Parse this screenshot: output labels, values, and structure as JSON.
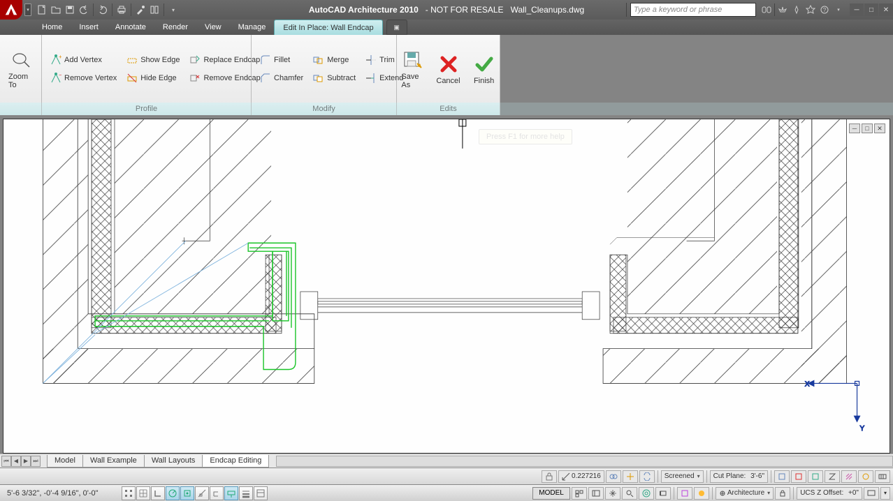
{
  "titlebar": {
    "app": "AutoCAD Architecture 2010",
    "warn": "- NOT FOR RESALE",
    "file": "Wall_Cleanups.dwg",
    "search_placeholder": "Type a keyword or phrase"
  },
  "menubar": {
    "items": [
      "Home",
      "Insert",
      "Annotate",
      "Render",
      "View",
      "Manage"
    ],
    "active": "Edit In Place: Wall Endcap"
  },
  "ribbon": {
    "zoom_to": "Zoom To",
    "profile": {
      "title": "Profile",
      "add_vertex": "Add Vertex",
      "remove_vertex": "Remove Vertex",
      "show_edge": "Show Edge",
      "hide_edge": "Hide Edge",
      "replace_endcap": "Replace Endcap",
      "remove_endcap": "Remove Endcap"
    },
    "modify": {
      "title": "Modify",
      "fillet": "Fillet",
      "chamfer": "Chamfer",
      "merge": "Merge",
      "subtract": "Subtract",
      "trim": "Trim",
      "extend": "Extend"
    },
    "edits": {
      "title": "Edits",
      "save_as": "Save As",
      "cancel": "Cancel",
      "finish": "Finish"
    }
  },
  "tooltip": "Press F1 for more help",
  "layout_tabs": {
    "items": [
      "Model",
      "Wall Example",
      "Wall Layouts",
      "Endcap Editing"
    ],
    "active_index": 3
  },
  "status1": {
    "scale_value": "0.227216",
    "visual_style": "Screened",
    "cut_plane_label": "Cut Plane:",
    "cut_plane_value": "3'-6\""
  },
  "status2": {
    "coords": "5'-6 3/32\",  -0'-4 9/16\",  0'-0\"",
    "model_btn": "MODEL",
    "workspace": "Architecture",
    "ucs_label": "UCS Z Offset:",
    "ucs_value": "+0\""
  }
}
